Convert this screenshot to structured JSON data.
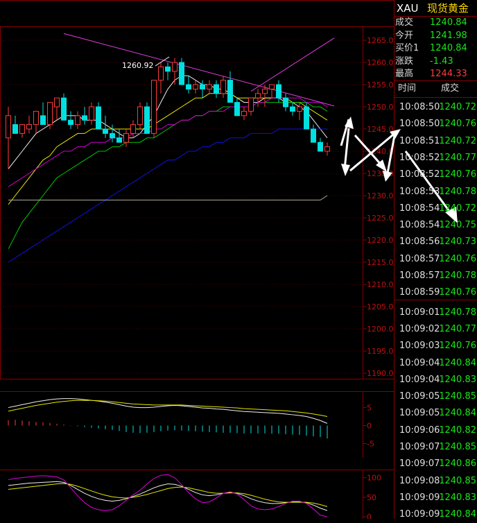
{
  "colors": {
    "up": "#ff3b3b",
    "down": "#00e0e0",
    "green": "#19e619",
    "yellow": "#f0e000",
    "grid": "#8b0000"
  },
  "panel": {
    "symbol": "XAU",
    "name": "现货黄金",
    "quote": [
      {
        "label": "成交",
        "value": "1240.84",
        "color": "#19e619"
      },
      {
        "label": "今开",
        "value": "1241.98",
        "color": "#19e619"
      },
      {
        "label": "买价1",
        "value": "1240.84",
        "color": "#19e619"
      },
      {
        "label": "涨跌",
        "value": "-1.43",
        "color": "#19e619"
      },
      {
        "label": "最高",
        "value": "1244.33",
        "color": "#ff3b3b"
      }
    ],
    "ticks_header": {
      "time": "时间",
      "price": "成交"
    },
    "ticks": [
      {
        "time": "10:08:50",
        "price": "1240.72"
      },
      {
        "time": "10:08:50",
        "price": "1240.76"
      },
      {
        "time": "10:08:51",
        "price": "1240.72"
      },
      {
        "time": "10:08:52",
        "price": "1240.77"
      },
      {
        "time": "10:08:52",
        "price": "1240.76"
      },
      {
        "time": "10:08:53",
        "price": "1240.78"
      },
      {
        "time": "10:08:54",
        "price": "1240.72"
      },
      {
        "time": "10:08:54",
        "price": "1240.75"
      },
      {
        "time": "10:08:56",
        "price": "1240.73"
      },
      {
        "time": "10:08:57",
        "price": "1240.76"
      },
      {
        "time": "10:08:57",
        "price": "1240.78"
      },
      {
        "time": "10:08:59",
        "price": "1240.76"
      },
      {
        "time": "10:09:01",
        "price": "1240.78"
      },
      {
        "time": "10:09:02",
        "price": "1240.77"
      },
      {
        "time": "10:09:03",
        "price": "1240.76"
      },
      {
        "time": "10:09:04",
        "price": "1240.84"
      },
      {
        "time": "10:09:04",
        "price": "1240.83"
      },
      {
        "time": "10:09:05",
        "price": "1240.85"
      },
      {
        "time": "10:09:05",
        "price": "1240.84"
      },
      {
        "time": "10:09:06",
        "price": "1240.82"
      },
      {
        "time": "10:09:07",
        "price": "1240.85"
      },
      {
        "time": "10:09:07",
        "price": "1240.86"
      },
      {
        "time": "10:09:08",
        "price": "1240.85"
      },
      {
        "time": "10:09:09",
        "price": "1240.83"
      },
      {
        "time": "10:09:09",
        "price": "1240.84"
      }
    ]
  },
  "chart_data": {
    "type": "candlestick",
    "y_ticks": [
      "1265.0",
      "1260.0",
      "1255.0",
      "1250.0",
      "1245.0",
      "1240.0",
      "1235.0",
      "1230.0",
      "1225.0",
      "1220.0",
      "1215.0",
      "1210.0",
      "1205.0",
      "1200.0",
      "1195.0",
      "1190.0"
    ],
    "ylim": [
      1190,
      1267.5
    ],
    "high_annotation": "1260.92",
    "candles": [
      [
        1243,
        1250,
        1236,
        1248
      ],
      [
        1246,
        1248,
        1244,
        1244
      ],
      [
        1244,
        1246,
        1243,
        1246
      ],
      [
        1245,
        1248,
        1244,
        1246
      ],
      [
        1246,
        1249,
        1244,
        1249
      ],
      [
        1248,
        1251,
        1246,
        1246
      ],
      [
        1246,
        1251,
        1245,
        1251
      ],
      [
        1250,
        1252,
        1247,
        1252
      ],
      [
        1252,
        1253,
        1247,
        1247
      ],
      [
        1247,
        1249,
        1245,
        1246
      ],
      [
        1246,
        1249,
        1245,
        1248
      ],
      [
        1248,
        1250,
        1246,
        1247
      ],
      [
        1247,
        1251,
        1246,
        1250
      ],
      [
        1250,
        1251,
        1245,
        1245
      ],
      [
        1245,
        1248,
        1243,
        1244
      ],
      [
        1244,
        1246,
        1242,
        1243
      ],
      [
        1243,
        1245,
        1242,
        1242
      ],
      [
        1242,
        1245,
        1241,
        1244
      ],
      [
        1244,
        1247,
        1243,
        1246
      ],
      [
        1246,
        1251,
        1245,
        1250
      ],
      [
        1250,
        1251,
        1244,
        1244
      ],
      [
        1244,
        1256,
        1243,
        1256
      ],
      [
        1256,
        1260,
        1253,
        1259
      ],
      [
        1259,
        1260,
        1256,
        1258
      ],
      [
        1258,
        1261,
        1255,
        1260
      ],
      [
        1260,
        1261,
        1255,
        1255
      ],
      [
        1255,
        1257,
        1253,
        1254
      ],
      [
        1254,
        1256,
        1253,
        1255
      ],
      [
        1255,
        1256,
        1252,
        1254
      ],
      [
        1254,
        1256,
        1253,
        1255
      ],
      [
        1255,
        1256,
        1252,
        1253
      ],
      [
        1253,
        1257,
        1252,
        1256
      ],
      [
        1256,
        1258,
        1251,
        1251
      ],
      [
        1251,
        1252,
        1248,
        1248
      ],
      [
        1248,
        1250,
        1247,
        1249
      ],
      [
        1249,
        1252,
        1248,
        1252
      ],
      [
        1252,
        1254,
        1250,
        1253
      ],
      [
        1253,
        1255,
        1250,
        1254
      ],
      [
        1254,
        1255,
        1252,
        1255
      ],
      [
        1255,
        1256,
        1251,
        1252
      ],
      [
        1252,
        1253,
        1249,
        1250
      ],
      [
        1250,
        1251,
        1248,
        1249
      ],
      [
        1249,
        1251,
        1247,
        1250
      ],
      [
        1250,
        1251,
        1245,
        1245
      ],
      [
        1245,
        1246,
        1242,
        1242
      ],
      [
        1242,
        1243,
        1240,
        1240
      ],
      [
        1240,
        1242,
        1239,
        1241
      ]
    ],
    "ma": [
      {
        "name": "white",
        "color": "#f0f0f0",
        "values": [
          1236,
          1238,
          1240,
          1242,
          1244,
          1245,
          1246,
          1247,
          1248,
          1248,
          1248,
          1247,
          1247,
          1247,
          1246,
          1245,
          1244,
          1243,
          1243,
          1244,
          1246,
          1248,
          1251,
          1254,
          1256,
          1257,
          1257,
          1256,
          1255,
          1255,
          1254,
          1254,
          1253,
          1252,
          1251,
          1251,
          1251,
          1252,
          1252,
          1252,
          1251,
          1251,
          1250,
          1249,
          1247,
          1245,
          1243
        ]
      },
      {
        "name": "yellow",
        "color": "#e8e800",
        "values": [
          1228,
          1230,
          1232,
          1234,
          1236,
          1238,
          1239,
          1241,
          1242,
          1243,
          1244,
          1244,
          1245,
          1245,
          1245,
          1245,
          1245,
          1245,
          1245,
          1245,
          1245,
          1246,
          1247,
          1248,
          1249,
          1250,
          1251,
          1252,
          1252,
          1253,
          1253,
          1253,
          1253,
          1252,
          1252,
          1252,
          1252,
          1252,
          1252,
          1252,
          1252,
          1251,
          1251,
          1250,
          1249,
          1248,
          1247
        ]
      },
      {
        "name": "green",
        "color": "#00c800",
        "values": [
          1218,
          1221,
          1224,
          1226,
          1228,
          1230,
          1232,
          1234,
          1235,
          1236,
          1237,
          1238,
          1239,
          1240,
          1240,
          1241,
          1241,
          1242,
          1242,
          1242,
          1243,
          1243,
          1244,
          1245,
          1246,
          1247,
          1247,
          1248,
          1248,
          1249,
          1249,
          1250,
          1250,
          1250,
          1250,
          1250,
          1251,
          1251,
          1251,
          1251,
          1251,
          1251,
          1251,
          1251,
          1250,
          1250,
          1249
        ]
      },
      {
        "name": "magenta",
        "color": "#d000d0",
        "values": [
          1232,
          1233,
          1234,
          1235,
          1236,
          1237,
          1238,
          1239,
          1240,
          1240,
          1241,
          1241,
          1242,
          1242,
          1242,
          1243,
          1243,
          1243,
          1244,
          1244,
          1244,
          1245,
          1245,
          1246,
          1246,
          1247,
          1247,
          1248,
          1248,
          1249,
          1249,
          1249,
          1250,
          1250,
          1250,
          1250,
          1251,
          1251,
          1252,
          1252,
          1252,
          1252,
          1252,
          1251,
          1251,
          1251,
          1250
        ]
      },
      {
        "name": "blue",
        "color": "#1010e0",
        "values": [
          1215,
          1216,
          1217,
          1218,
          1219,
          1220,
          1221,
          1222,
          1223,
          1224,
          1225,
          1226,
          1227,
          1228,
          1229,
          1230,
          1231,
          1232,
          1233,
          1234,
          1235,
          1236,
          1237,
          1238,
          1238,
          1239,
          1240,
          1240,
          1241,
          1241,
          1242,
          1242,
          1243,
          1243,
          1243,
          1244,
          1244,
          1244,
          1244,
          1245,
          1245,
          1245,
          1245,
          1245,
          1245,
          1245,
          1245
        ]
      },
      {
        "name": "gray",
        "color": "#b0b0a0",
        "values": [
          1229,
          1229,
          1229,
          1229,
          1229,
          1229,
          1229,
          1229,
          1229,
          1229,
          1229,
          1229,
          1229,
          1229,
          1229,
          1229,
          1229,
          1229,
          1229,
          1229,
          1229,
          1229,
          1229,
          1229,
          1229,
          1229,
          1229,
          1229,
          1229,
          1229,
          1229,
          1229,
          1229,
          1229,
          1229,
          1229,
          1229,
          1229,
          1229,
          1229,
          1229,
          1229,
          1229,
          1229,
          1229,
          1229,
          1230
        ]
      }
    ],
    "macd": {
      "y_ticks": [
        "5",
        "0",
        "-5"
      ],
      "ylim": [
        -8,
        8
      ],
      "dif": [
        5,
        5.4,
        5.8,
        6.2,
        6.6,
        6.9,
        7.2,
        7.4,
        7.5,
        7.5,
        7.4,
        7.2,
        7.0,
        6.8,
        6.5,
        6.2,
        5.8,
        5.4,
        5.1,
        5.0,
        5.0,
        5.1,
        5.3,
        5.5,
        5.6,
        5.5,
        5.3,
        5.1,
        4.9,
        4.8,
        4.6,
        4.5,
        4.3,
        4.1,
        3.9,
        3.8,
        3.7,
        3.6,
        3.5,
        3.4,
        3.2,
        3.0,
        2.8,
        2.5,
        2.0,
        1.4,
        0.6
      ],
      "dea": [
        4,
        4.4,
        4.8,
        5.2,
        5.6,
        5.9,
        6.2,
        6.5,
        6.7,
        6.9,
        7.0,
        7.0,
        7.0,
        6.9,
        6.8,
        6.6,
        6.4,
        6.2,
        6.0,
        5.9,
        5.8,
        5.7,
        5.7,
        5.7,
        5.7,
        5.7,
        5.6,
        5.5,
        5.4,
        5.3,
        5.2,
        5.1,
        5.0,
        4.9,
        4.7,
        4.6,
        4.5,
        4.4,
        4.3,
        4.2,
        4.1,
        3.9,
        3.7,
        3.5,
        3.2,
        2.9,
        2.5
      ],
      "hist": [
        1.5,
        1.6,
        1.4,
        1.2,
        1.0,
        0.9,
        0.7,
        0.5,
        0.3,
        0.1,
        -0.2,
        -0.4,
        -0.6,
        -0.8,
        -1.0,
        -1.2,
        -1.5,
        -1.8,
        -2.0,
        -2.1,
        -2.0,
        -1.8,
        -1.6,
        -1.4,
        -1.3,
        -1.4,
        -1.5,
        -1.6,
        -1.7,
        -1.8,
        -1.9,
        -2.0,
        -2.0,
        -2.1,
        -2.2,
        -2.2,
        -2.2,
        -2.2,
        -2.3,
        -2.3,
        -2.4,
        -2.5,
        -2.6,
        -2.8,
        -3.0,
        -3.2,
        -3.6
      ]
    },
    "kdj": {
      "y_ticks": [
        "100",
        "50",
        "0"
      ],
      "ylim": [
        0,
        110
      ],
      "k": [
        80,
        82,
        84,
        86,
        87,
        88,
        89,
        90,
        88,
        80,
        70,
        60,
        52,
        46,
        42,
        40,
        42,
        46,
        52,
        58,
        66,
        74,
        80,
        84,
        83,
        78,
        70,
        62,
        56,
        54,
        56,
        60,
        62,
        60,
        54,
        46,
        40,
        36,
        34,
        34,
        36,
        38,
        38,
        36,
        30,
        22,
        16
      ],
      "d": [
        70,
        72,
        74,
        76,
        78,
        80,
        82,
        84,
        85,
        83,
        78,
        72,
        66,
        60,
        55,
        51,
        49,
        48,
        50,
        53,
        57,
        62,
        67,
        72,
        75,
        76,
        74,
        70,
        66,
        62,
        60,
        60,
        61,
        61,
        59,
        55,
        50,
        45,
        41,
        38,
        37,
        37,
        37,
        37,
        35,
        31,
        26
      ],
      "j": [
        95,
        98,
        100,
        102,
        104,
        105,
        104,
        102,
        94,
        74,
        54,
        36,
        24,
        18,
        16,
        18,
        28,
        42,
        56,
        68,
        84,
        98,
        106,
        108,
        100,
        82,
        62,
        46,
        36,
        38,
        48,
        60,
        64,
        58,
        44,
        28,
        20,
        18,
        20,
        26,
        34,
        40,
        40,
        34,
        20,
        4,
        0
      ]
    },
    "trendlines": [
      {
        "color": "#e040e0",
        "from": [
          8,
          1266.5
        ],
        "to": [
          47,
          1250.2
        ]
      },
      {
        "color": "#e040e0",
        "from": [
          35,
          1253.5
        ],
        "to": [
          47,
          1265.5
        ]
      }
    ]
  }
}
